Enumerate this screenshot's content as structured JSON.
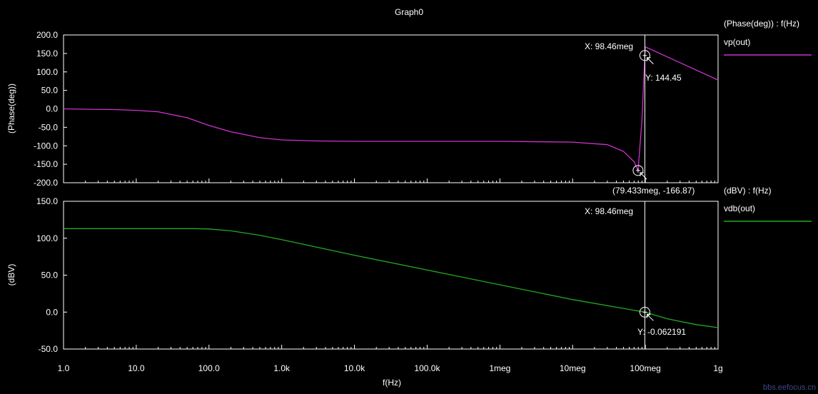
{
  "window": {
    "title": "Graph0",
    "watermark": "bbs.eefocus.cn"
  },
  "colors": {
    "background": "#000000",
    "axes": "#ffffff",
    "phase_trace": "#cc33cc",
    "db_trace": "#22aa22",
    "cursor": "#ffffff"
  },
  "x_axis": {
    "label": "f(Hz)",
    "scale": "log",
    "range": [
      1,
      1000000000
    ],
    "tick_values": [
      1,
      10,
      100,
      1000,
      10000,
      100000,
      1000000,
      10000000,
      100000000,
      1000000000
    ],
    "tick_labels": [
      "1.0",
      "10.0",
      "100.0",
      "1.0k",
      "10.0k",
      "100.0k",
      "1meg",
      "10meg",
      "100meg",
      "1g"
    ]
  },
  "cursor": {
    "x_value": 98460000
  },
  "chart_data": [
    {
      "type": "line",
      "title": "",
      "xlabel": "f(Hz)",
      "ylabel": "(Phase(deg))",
      "ylim": [
        -200,
        200
      ],
      "yticks": [
        200,
        150,
        100,
        50,
        0,
        -50,
        -100,
        -150,
        -200
      ],
      "ytick_labels": [
        "200.0",
        "150.0",
        "100.0",
        "50.0",
        "0.0",
        "-50.0",
        "-100.0",
        "-150.0",
        "-200.0"
      ],
      "grid": false,
      "legend_position": "right",
      "legend_header": "(Phase(deg)) : f(Hz)",
      "series": [
        {
          "name": "vp(out)",
          "x": [
            1,
            2,
            5,
            10,
            20,
            50,
            100,
            200,
            500,
            1000,
            3000,
            10000,
            100000,
            1000000,
            10000000,
            30000000,
            50000000,
            70000000,
            79433000,
            90000000,
            98460000,
            100000000,
            300000000,
            1000000000
          ],
          "y": [
            0,
            -1,
            -2,
            -4,
            -8,
            -24,
            -45,
            -62,
            -78,
            -84,
            -87,
            -88,
            -88,
            -88,
            -90,
            -97,
            -115,
            -143,
            -166.87,
            -30,
            144.45,
            168,
            125,
            78
          ]
        }
      ],
      "annotations": [
        {
          "label": "X: 98.46meg",
          "x": 98460000,
          "y": 144.45
        },
        {
          "label": "Y: 144.45",
          "x": 98460000,
          "y": 144.45
        },
        {
          "label": "(79.433meg, -166.87)",
          "x": 79433000,
          "y": -166.87
        }
      ]
    },
    {
      "type": "line",
      "title": "",
      "xlabel": "f(Hz)",
      "ylabel": "(dBV)",
      "ylim": [
        -50,
        150
      ],
      "yticks": [
        150,
        100,
        50,
        0,
        -50
      ],
      "ytick_labels": [
        "150.0",
        "100.0",
        "50.0",
        "0.0",
        "-50.0"
      ],
      "grid": false,
      "legend_position": "right",
      "legend_header": "(dBV) : f(Hz)",
      "series": [
        {
          "name": "vdb(out)",
          "x": [
            1,
            10,
            60,
            100,
            200,
            500,
            1000,
            10000,
            100000,
            1000000,
            10000000,
            50000000,
            98460000,
            200000000,
            500000000,
            1000000000
          ],
          "y": [
            113,
            113,
            113,
            112.5,
            110,
            104,
            98,
            77,
            57,
            37,
            17,
            5,
            -0.062191,
            -9,
            -17,
            -21
          ]
        }
      ],
      "annotations": [
        {
          "label": "X: 98.46meg",
          "x": 98460000,
          "y": -0.062191
        },
        {
          "label": "Y: -0.062191",
          "x": 98460000,
          "y": -0.062191
        }
      ]
    }
  ]
}
